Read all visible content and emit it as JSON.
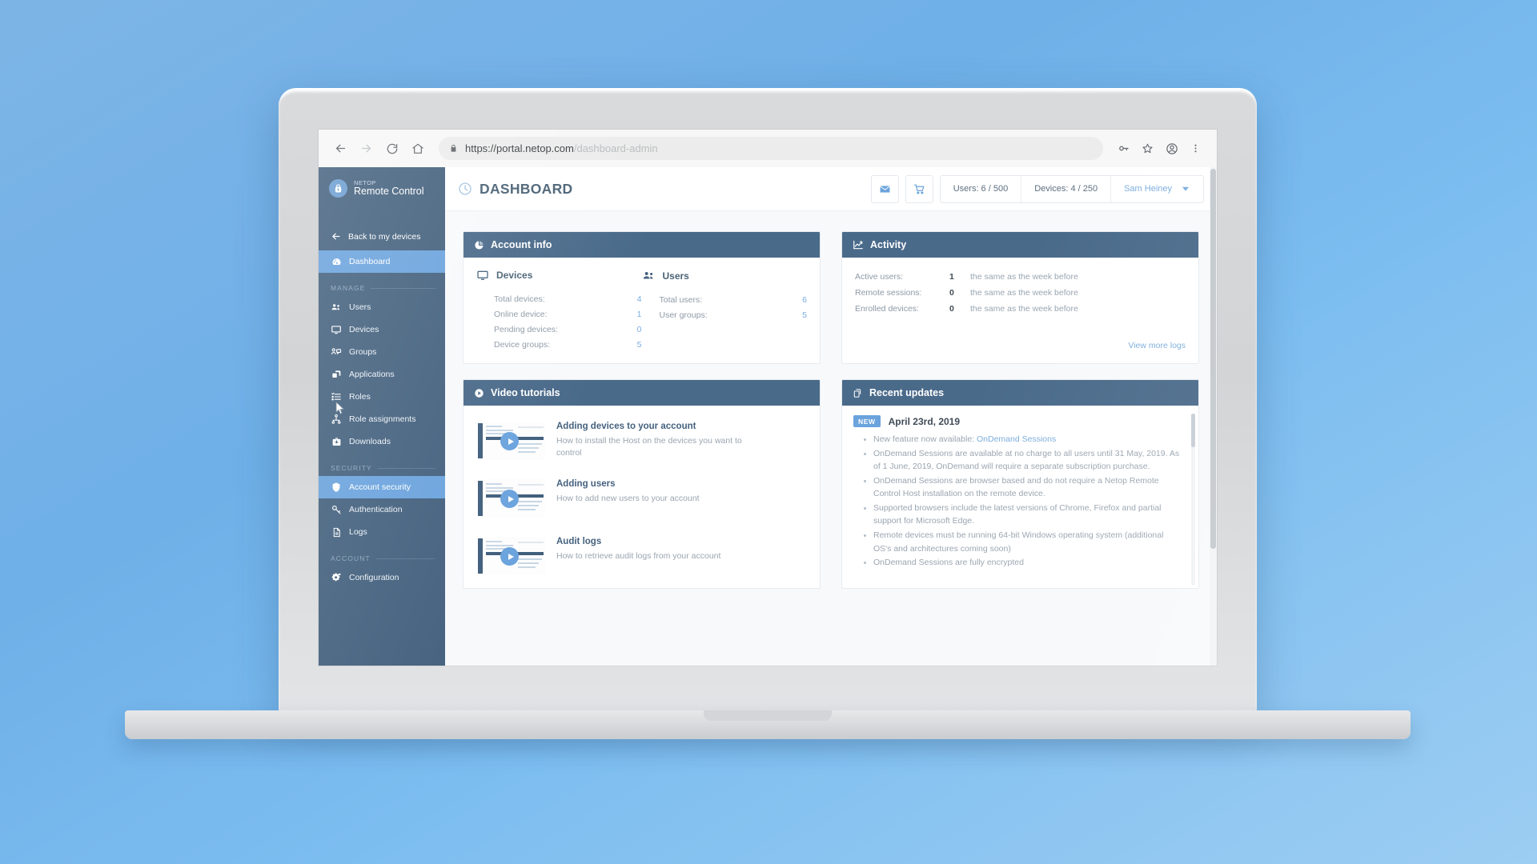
{
  "browser": {
    "back_icon": "arrow-left-icon",
    "forward_icon": "arrow-right-icon",
    "reload_icon": "reload-icon",
    "home_icon": "home-icon",
    "lock_icon": "lock-icon",
    "url_scheme": "https://",
    "url_domain": "portal.netop.com",
    "url_path": "/dashboard-admin",
    "key_icon": "key-icon",
    "star_icon": "star-icon",
    "profile_icon": "profile-avatar-icon",
    "menu_icon": "kebab-menu-icon"
  },
  "sidebar": {
    "brand_kicker": "NETOP",
    "brand_title": "Remote Control",
    "back_label": "Back to my devices",
    "dashboard_label": "Dashboard",
    "sections": [
      {
        "label": "MANAGE",
        "items": [
          {
            "label": "Users",
            "icon": "users-icon"
          },
          {
            "label": "Devices",
            "icon": "monitor-icon"
          },
          {
            "label": "Groups",
            "icon": "groups-icon"
          },
          {
            "label": "Applications",
            "icon": "applications-icon"
          },
          {
            "label": "Roles",
            "icon": "list-check-icon"
          },
          {
            "label": "Role assignments",
            "icon": "org-tree-icon"
          },
          {
            "label": "Downloads",
            "icon": "download-box-icon"
          }
        ]
      },
      {
        "label": "SECURITY",
        "items": [
          {
            "label": "Account security",
            "icon": "shield-lock-icon"
          },
          {
            "label": "Authentication",
            "icon": "key-icon"
          },
          {
            "label": "Logs",
            "icon": "document-icon"
          }
        ]
      },
      {
        "label": "ACCOUNT",
        "items": [
          {
            "label": "Configuration",
            "icon": "gears-icon"
          }
        ]
      }
    ]
  },
  "header": {
    "title": "DASHBOARD",
    "title_icon": "clock-icon",
    "mail_button_icon": "envelope-icon",
    "cart_button_icon": "shopping-cart-icon",
    "users_quota": "Users: 6 / 500",
    "devices_quota": "Devices: 4 / 250",
    "user_name": "Sam Heiney",
    "user_caret_icon": "chevron-down-icon"
  },
  "account_info": {
    "title": "Account info",
    "icon": "pie-chart-icon",
    "devices": {
      "heading": "Devices",
      "icon": "monitor-icon",
      "rows": [
        {
          "label": "Total devices:",
          "value": "4"
        },
        {
          "label": "Online device:",
          "value": "1"
        },
        {
          "label": "Pending devices:",
          "value": "0"
        },
        {
          "label": "Device groups:",
          "value": "5"
        }
      ]
    },
    "users": {
      "heading": "Users",
      "icon": "users-icon",
      "rows": [
        {
          "label": "Total users:",
          "value": "6"
        },
        {
          "label": "User groups:",
          "value": "5"
        }
      ]
    }
  },
  "activity": {
    "title": "Activity",
    "icon": "line-chart-icon",
    "rows": [
      {
        "label": "Active users:",
        "value": "1",
        "note": "the same as the week before"
      },
      {
        "label": "Remote sessions:",
        "value": "0",
        "note": "the same as the week before"
      },
      {
        "label": "Enrolled devices:",
        "value": "0",
        "note": "the same as the week before"
      }
    ],
    "view_more_label": "View more logs"
  },
  "video_tutorials": {
    "title": "Video tutorials",
    "icon": "play-circle-icon",
    "items": [
      {
        "title": "Adding devices to your account",
        "desc": "How to install the Host on the devices you want to control"
      },
      {
        "title": "Adding users",
        "desc": "How to add new users to your account"
      },
      {
        "title": "Audit logs",
        "desc": "How to retrieve audit logs from your account"
      }
    ]
  },
  "recent_updates": {
    "title": "Recent updates",
    "icon": "copy-pages-icon",
    "badge": "NEW",
    "date": "April 23rd, 2019",
    "items": [
      {
        "text": "New feature now available: ",
        "link": "OnDemand Sessions"
      },
      {
        "text": "OnDemand Sessions are available at no charge to all users until 31 May, 2019. As of 1 June, 2019, OnDemand will require a separate subscription purchase."
      },
      {
        "text": "OnDemand Sessions are browser based and do not require a Netop Remote Control Host installation on the remote device."
      },
      {
        "text": "Supported browsers include the latest versions of Chrome, Firefox and partial support for Microsoft Edge."
      },
      {
        "text": "Remote devices must be running 64-bit Windows operating system (additional OS's and architectures coming soon)"
      },
      {
        "text": "OnDemand Sessions are fully encrypted"
      }
    ]
  },
  "colors": {
    "sidebar_bg": "#44617e",
    "card_head_bg": "#4a6a8a",
    "accent_blue": "#6ba3dd",
    "link_blue": "#7badde",
    "desktop_bg": "#7db4e6"
  }
}
